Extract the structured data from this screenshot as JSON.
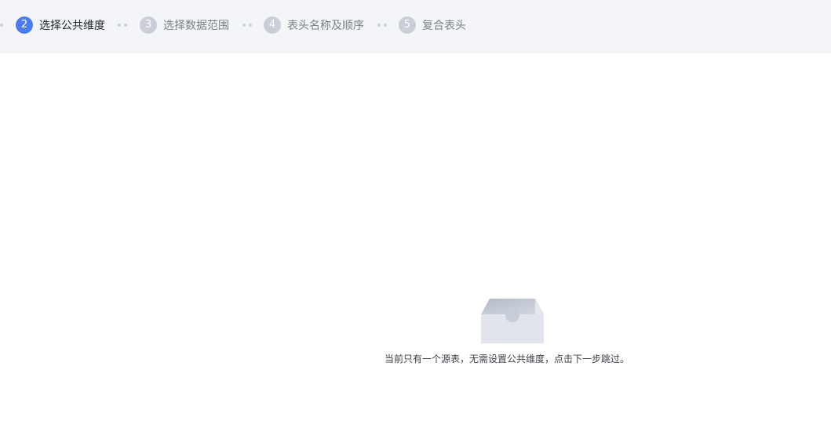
{
  "steps": [
    {
      "number": "2",
      "label": "选择公共维度",
      "state": "active"
    },
    {
      "number": "3",
      "label": "选择数据范围",
      "state": "pending"
    },
    {
      "number": "4",
      "label": "表头名称及顺序",
      "state": "pending"
    },
    {
      "number": "5",
      "label": "复合表头",
      "state": "pending"
    }
  ],
  "empty_state": {
    "icon": "empty-box-icon",
    "message": "当前只有一个源表，无需设置公共维度，点击下一步跳过。"
  },
  "colors": {
    "accent": "#4b7cf3",
    "pending_step": "#c9ced9",
    "header_bg": "#f4f5f8"
  }
}
